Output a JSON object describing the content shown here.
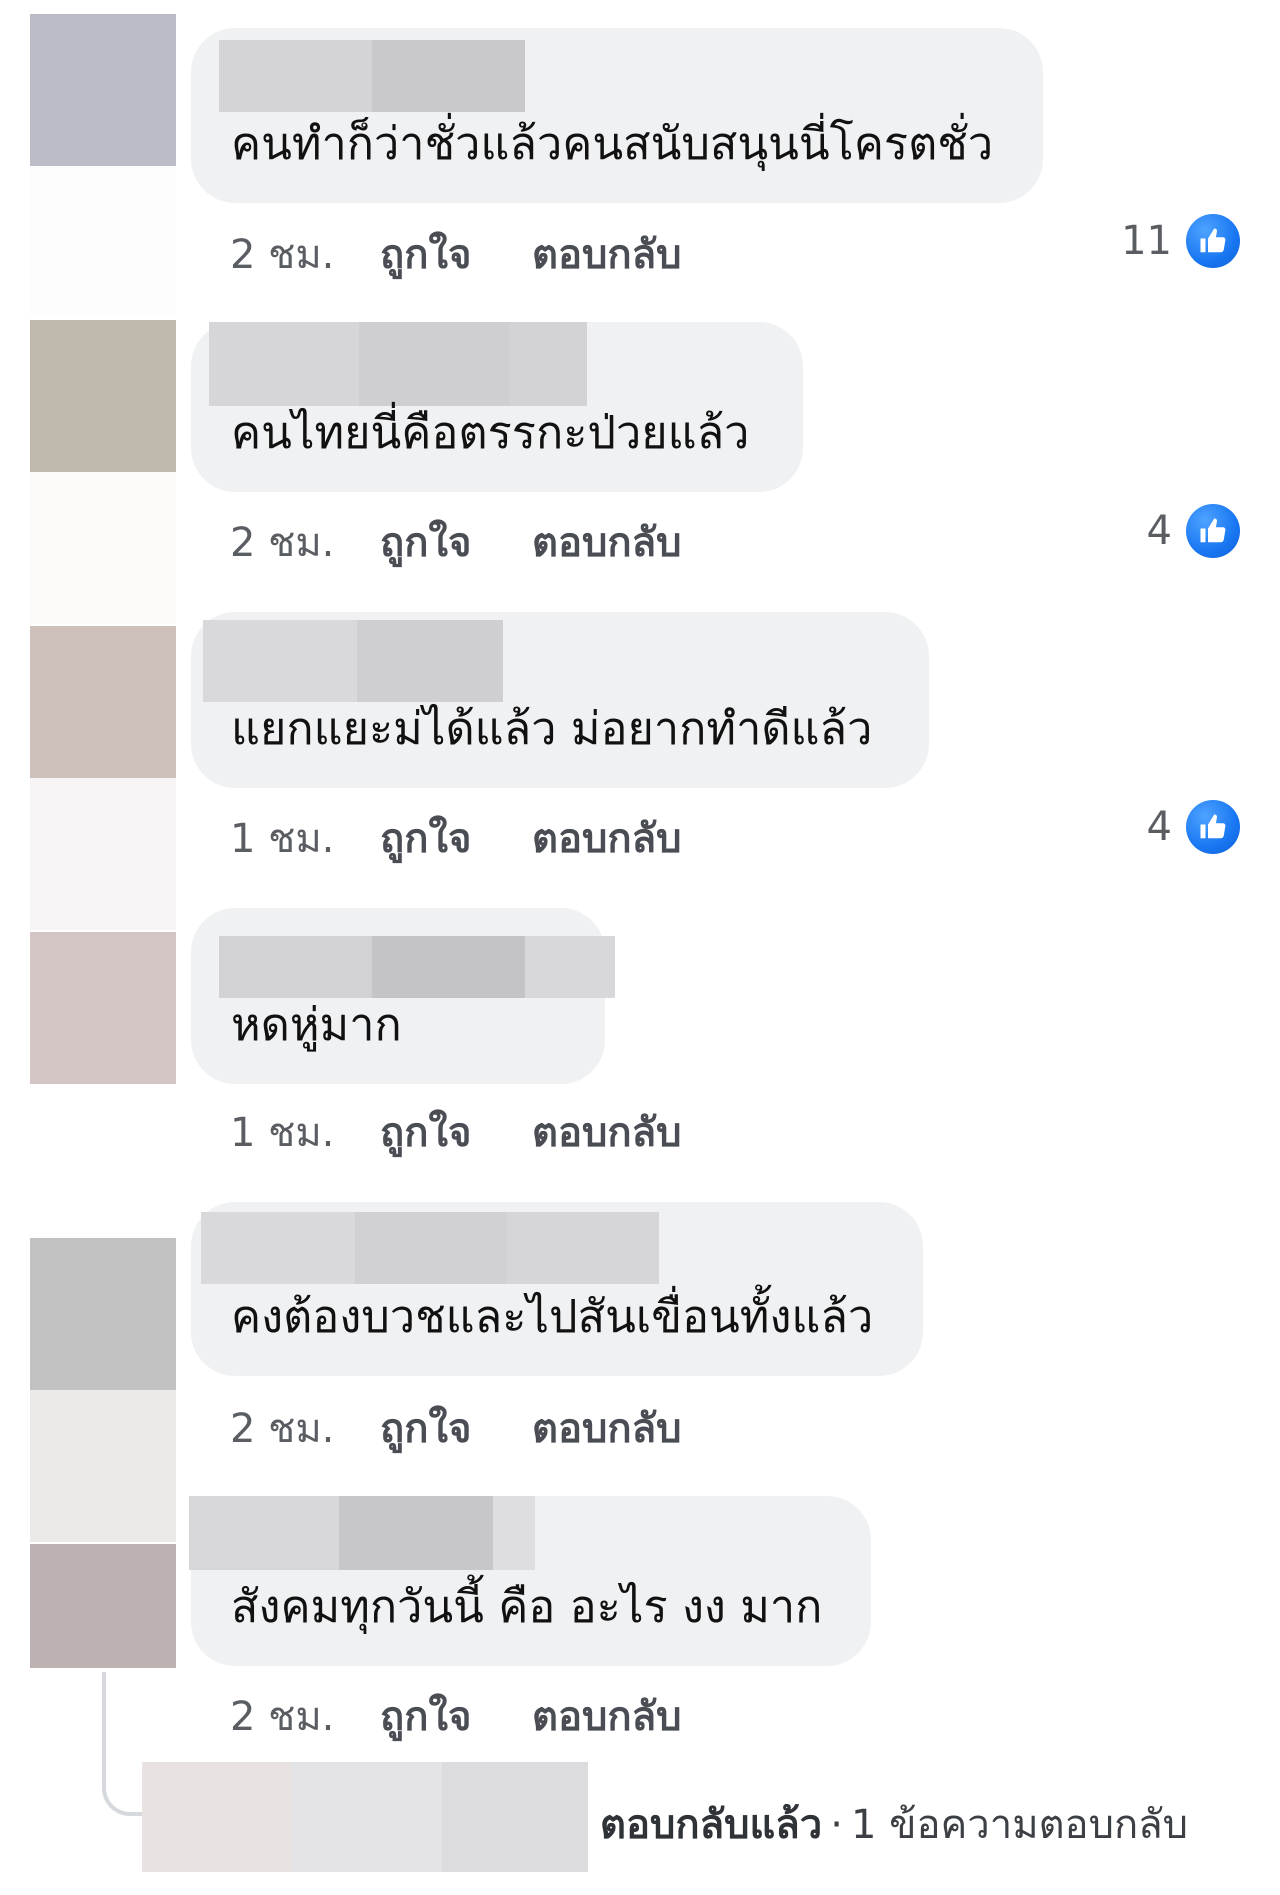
{
  "comments": [
    {
      "text": "คนทำก็ว่าชั่วแล้วคนสนับสนุนนี่โครตชั่ว",
      "time": "2 ชม.",
      "like_label": "ถูกใจ",
      "reply_label": "ตอบกลับ",
      "reactions": "11"
    },
    {
      "text": "คนไทยนี่คือตรรกะป่วยแล้ว",
      "time": "2 ชม.",
      "like_label": "ถูกใจ",
      "reply_label": "ตอบกลับ",
      "reactions": "4"
    },
    {
      "text": "แยกแยะม่ได้แล้ว ม่อยากทำดีแล้ว",
      "time": "1 ชม.",
      "like_label": "ถูกใจ",
      "reply_label": "ตอบกลับ",
      "reactions": "4"
    },
    {
      "text": "หดหู่มาก",
      "time": "1 ชม.",
      "like_label": "ถูกใจ",
      "reply_label": "ตอบกลับ"
    },
    {
      "text": "คงต้องบวชและไปสันเขื่อนทั้งแล้ว",
      "time": "2 ชม.",
      "like_label": "ถูกใจ",
      "reply_label": "ตอบกลับ"
    },
    {
      "text": "สังคมทุกวันนี้ คือ อะไร งง มาก",
      "time": "2 ชม.",
      "like_label": "ถูกใจ",
      "reply_label": "ตอบกลับ"
    }
  ],
  "reply_summary": {
    "main": "ตอบกลับแล้ว",
    "separator": "·",
    "count": "1 ข้อความตอบกลับ"
  },
  "colors": {
    "like_blue": "#1877f2",
    "bubble_bg": "#eff1f3"
  },
  "icons": {
    "like": "thumbs-up-icon"
  }
}
